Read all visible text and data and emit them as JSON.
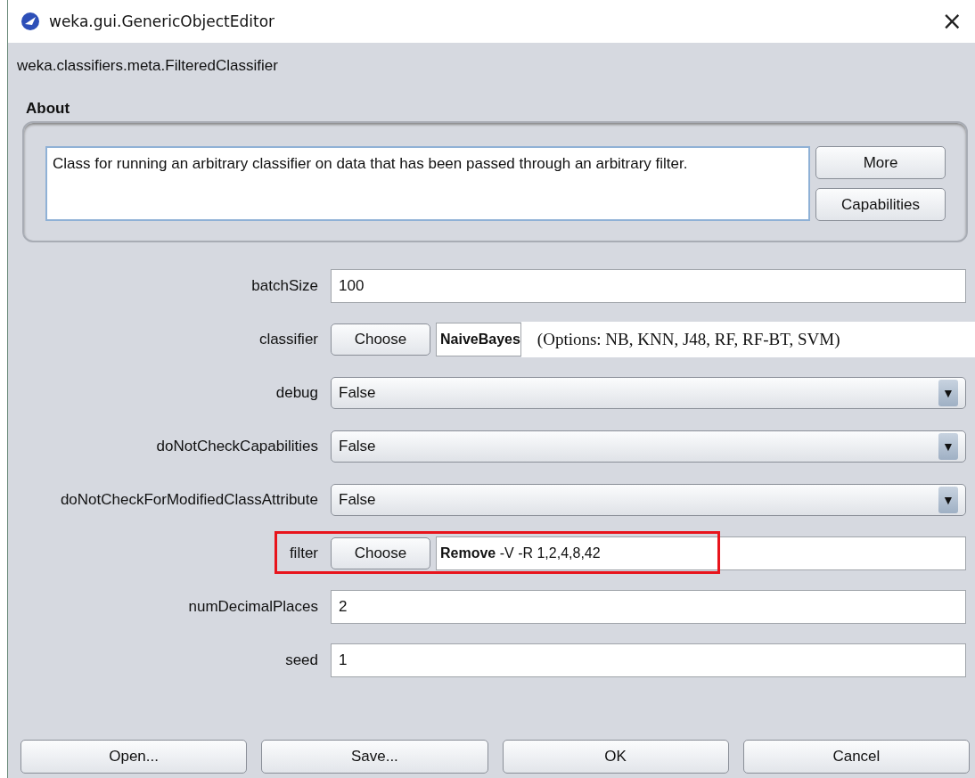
{
  "window": {
    "title": "weka.gui.GenericObjectEditor",
    "close": "×"
  },
  "class_name": "weka.classifiers.meta.FilteredClassifier",
  "about": {
    "heading": "About",
    "text": "Class for running an arbitrary classifier on data that has been passed through an arbitrary filter.",
    "buttons": [
      "More",
      "Capabilities"
    ]
  },
  "properties": [
    {
      "label": "batchSize",
      "kind": "text",
      "value": "100",
      "highlighted": false
    },
    {
      "label": "classifier",
      "kind": "object",
      "button": "Choose",
      "value": "**NaiveBayes**",
      "note": "(Options: NB, KNN, J48, RF, RF-BT, SVM)",
      "highlighted": false
    },
    {
      "label": "debug",
      "kind": "dropdown",
      "value": "False",
      "arrow": "▼",
      "highlighted": false
    },
    {
      "label": "doNotCheckCapabilities",
      "kind": "dropdown",
      "value": "False",
      "arrow": "▼",
      "highlighted": false
    },
    {
      "label": "doNotCheckForModifiedClassAttribute",
      "kind": "dropdown",
      "value": "False",
      "arrow": "▼",
      "highlighted": false
    },
    {
      "label": "filter",
      "kind": "object",
      "button": "Choose",
      "value": "**Remove** -V -R 1,2,4,8,42",
      "highlighted": true
    },
    {
      "label": "numDecimalPlaces",
      "kind": "text",
      "value": "2",
      "highlighted": false
    },
    {
      "label": "seed",
      "kind": "text",
      "value": "1",
      "highlighted": false
    }
  ],
  "buttons": [
    "Open...",
    "Save...",
    "OK",
    "Cancel"
  ]
}
